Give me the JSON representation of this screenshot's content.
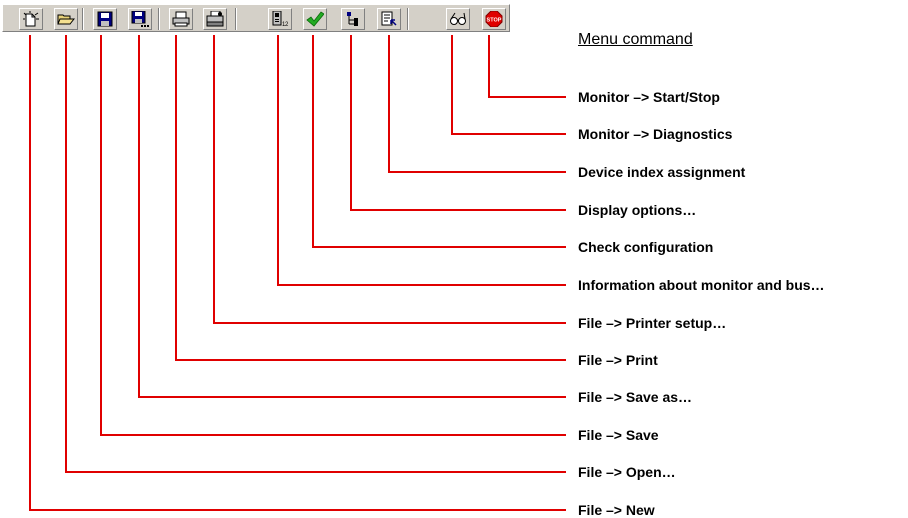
{
  "heading": "Menu command",
  "colors": {
    "leader": "#e00000",
    "toolbar": "#d4d0c8"
  },
  "buttons": [
    {
      "icon": "new-file-icon",
      "label": "File –> New"
    },
    {
      "icon": "open-folder-icon",
      "label": "File –> Open…"
    },
    {
      "icon": "floppy-save-icon",
      "label": "File –> Save"
    },
    {
      "icon": "floppy-save-as-icon",
      "label": "File –> Save as…"
    },
    {
      "icon": "printer-icon",
      "label": "File –> Print"
    },
    {
      "icon": "printer-setup-icon",
      "label": "File –> Printer setup…"
    },
    {
      "icon": "monitor-bus-info-icon",
      "label": "Information about monitor and bus…"
    },
    {
      "icon": "checkmark-icon",
      "label": "Check configuration"
    },
    {
      "icon": "tree-options-icon",
      "label": "Display options…"
    },
    {
      "icon": "device-index-icon",
      "label": "Device index assignment"
    },
    {
      "icon": "glasses-icon",
      "label": "Monitor –> Diagnostics"
    },
    {
      "icon": "stop-sign-icon",
      "label": "Monitor –> Start/Stop"
    }
  ]
}
